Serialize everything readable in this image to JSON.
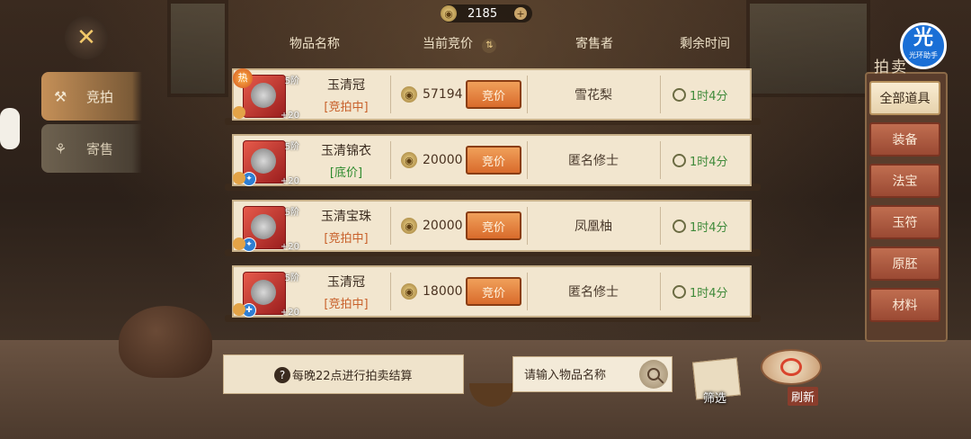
{
  "balance": {
    "amount": "2185",
    "coin_icon": "coin-icon",
    "plus_icon": "plus-icon"
  },
  "nav": {
    "tabs": [
      {
        "label": "竞拍",
        "icon": "auction-icon",
        "active": true
      },
      {
        "label": "寄售",
        "icon": "consign-icon",
        "active": false
      }
    ]
  },
  "table": {
    "headers": {
      "item_name": "物品名称",
      "current_bid": "当前竞价",
      "seller": "寄售者",
      "remaining_time": "剩余时间"
    },
    "rows": [
      {
        "name": "玉清冠",
        "status": "[竞拍中]",
        "status_type": "bidding",
        "tier": "5阶",
        "enhance": "+20",
        "hot_badge": "热",
        "price": "57194",
        "bid_label": "竞价",
        "seller": "雪花梨",
        "time": "1时4分"
      },
      {
        "name": "玉清锦衣",
        "status": "[底价]",
        "status_type": "floor",
        "tier": "5阶",
        "enhance": "+20",
        "hot_badge": "",
        "price": "20000",
        "bid_label": "竞价",
        "seller": "匿名修士",
        "time": "1时4分"
      },
      {
        "name": "玉清宝珠",
        "status": "[竞拍中]",
        "status_type": "bidding",
        "tier": "5阶",
        "enhance": "+20",
        "hot_badge": "",
        "price": "20000",
        "bid_label": "竞价",
        "seller": "凤凰柚",
        "time": "1时4分"
      },
      {
        "name": "玉清冠",
        "status": "[竞拍中]",
        "status_type": "bidding",
        "tier": "5阶",
        "enhance": "+20",
        "hot_badge": "",
        "price": "18000",
        "bid_label": "竞价",
        "seller": "匿名修士",
        "time": "1时4分"
      }
    ]
  },
  "categories": {
    "title": "拍卖",
    "items": [
      "全部道具",
      "装备",
      "法宝",
      "玉符",
      "原胚",
      "材料"
    ],
    "active": "全部道具"
  },
  "assistant": {
    "big": "光",
    "small": "光环助手"
  },
  "bottom": {
    "tip": "每晚22点进行拍卖结算",
    "search_placeholder": "请输入物品名称",
    "filter_label": "筛选",
    "refresh_label": "刷新"
  },
  "colors": {
    "status_bidding": "#c8602a",
    "status_floor": "#2c8a2c",
    "time_green": "#3f8a3a",
    "bid_button": "#e07a35"
  }
}
